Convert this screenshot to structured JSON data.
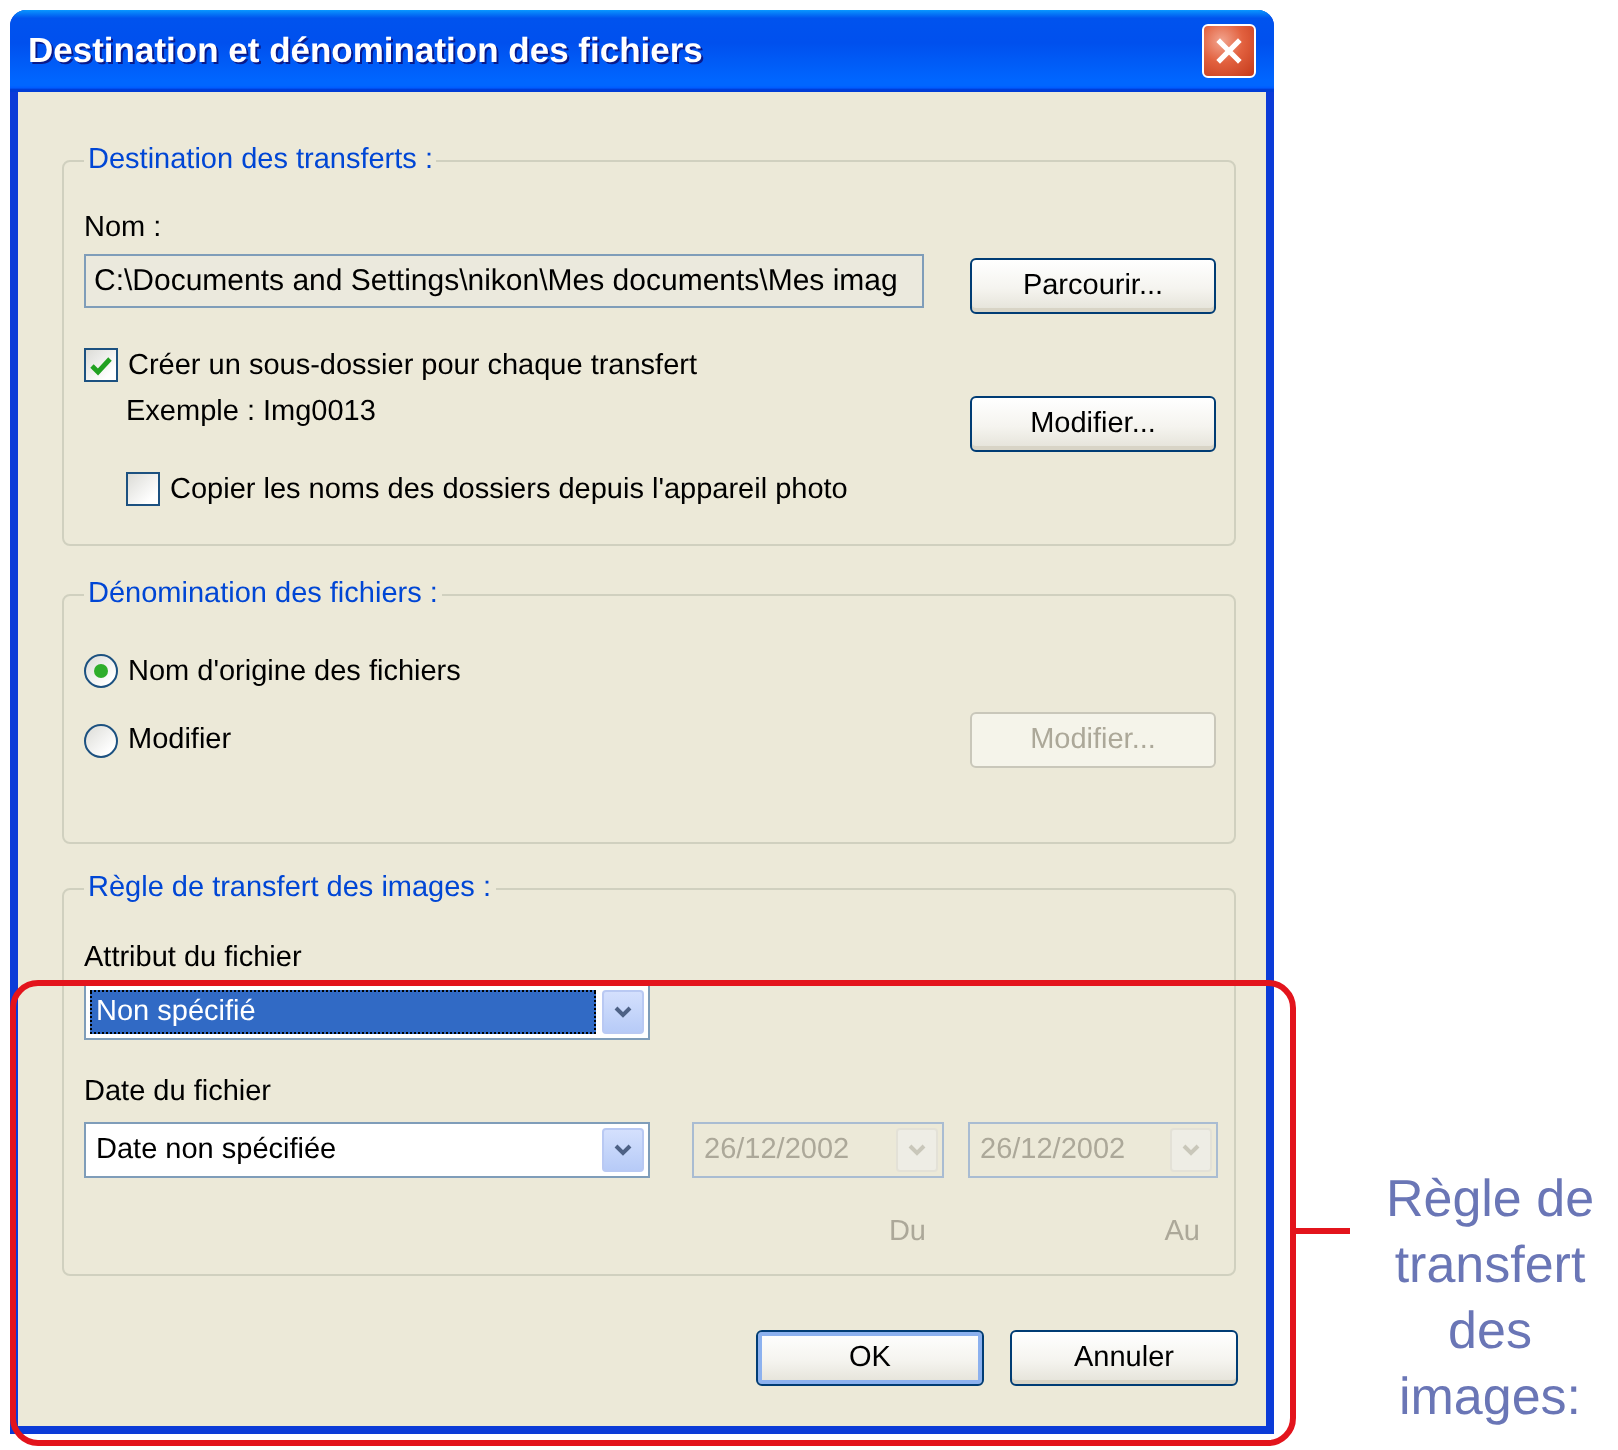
{
  "window": {
    "title": "Destination et dénomination des fichiers"
  },
  "destination": {
    "legend": "Destination des transferts :",
    "name_label": "Nom :",
    "path": {
      "value": "C:\\Documents and Settings\\nikon\\Mes documents\\Mes imag",
      "read_only": true
    },
    "browse_button": {
      "label": "Parcourir...",
      "disabled": false
    },
    "subfolder": {
      "label": "Créer un sous-dossier pour chaque transfert",
      "checked": true
    },
    "example": "Exemple : Img0013",
    "modify_button": {
      "label": "Modifier...",
      "disabled": false
    },
    "copy_names": {
      "label": "Copier les noms des dossiers depuis l'appareil photo",
      "checked": false
    }
  },
  "naming": {
    "legend": "Dénomination des fichiers :",
    "options": [
      {
        "label": "Nom d'origine des fichiers",
        "selected": true
      },
      {
        "label": "Modifier",
        "selected": false
      }
    ],
    "modify_button": {
      "label": "Modifier...",
      "disabled": true
    }
  },
  "transfer_rule": {
    "legend": "Règle de transfert des images :",
    "attribute": {
      "label": "Attribut du fichier",
      "value": "Non spécifié",
      "focused": true
    },
    "date": {
      "label": "Date du fichier",
      "value": "Date non spécifiée",
      "focused": false
    },
    "from": {
      "value": "26/12/2002",
      "disabled": true,
      "caption": "Du"
    },
    "to": {
      "value": "26/12/2002",
      "disabled": true,
      "caption": "Au"
    }
  },
  "buttons": [
    {
      "label": "OK",
      "default": true
    },
    {
      "label": "Annuler",
      "default": false
    }
  ],
  "callout": {
    "text": "Règle de transfert des images:"
  }
}
